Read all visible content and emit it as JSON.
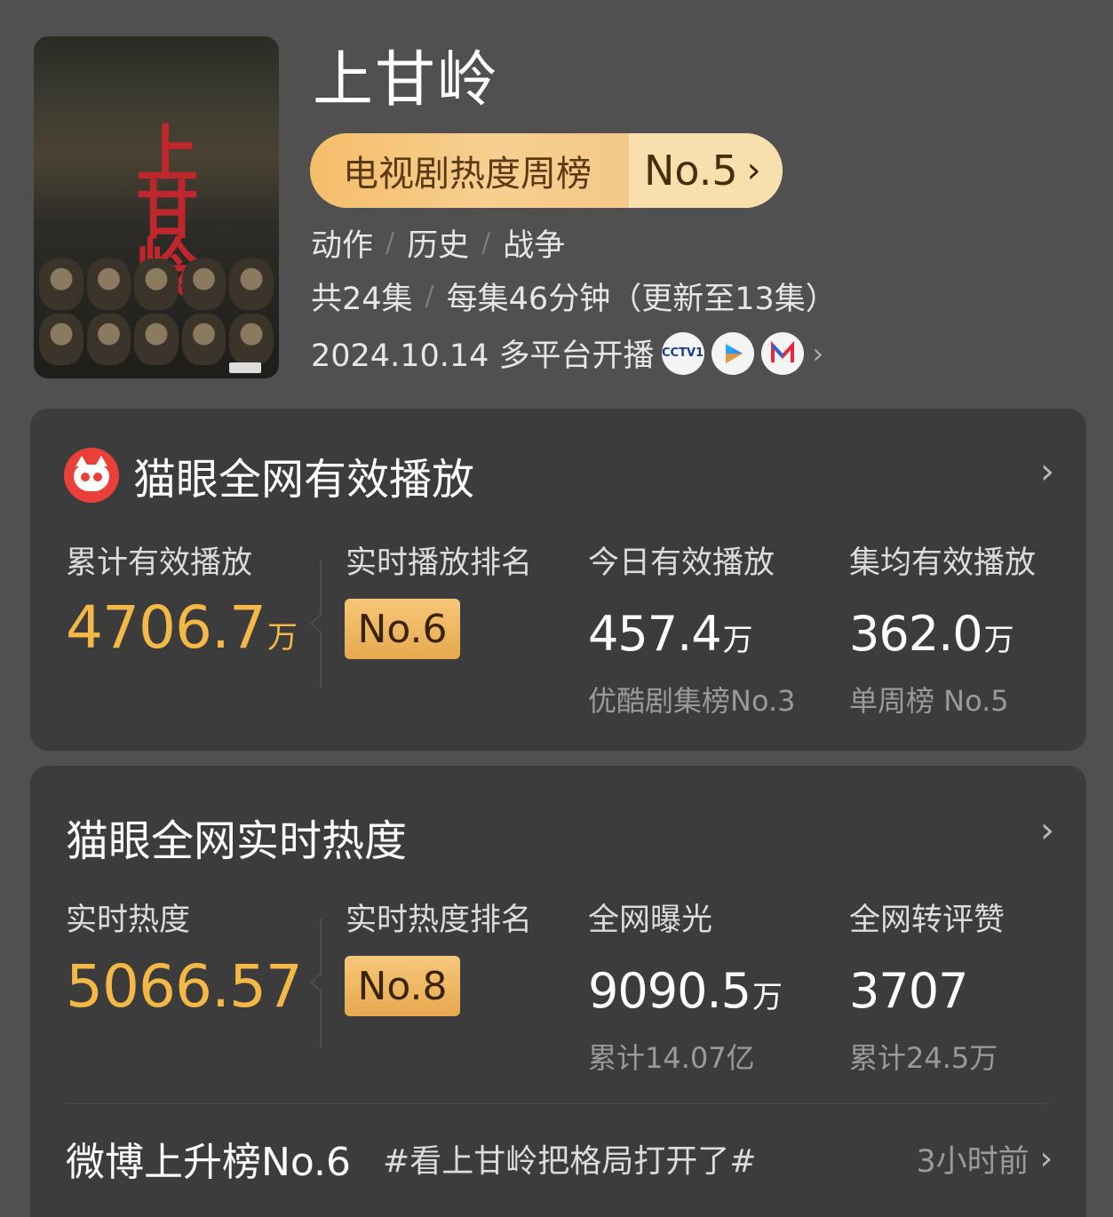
{
  "header": {
    "title": "上甘岭",
    "poster_text": "上甘岭",
    "rank_pill": {
      "label": "电视剧热度周榜",
      "rank": "No.5",
      "chevron": "›"
    },
    "genres": [
      "动作",
      "历史",
      "战争"
    ],
    "separator": "/",
    "episodes": {
      "count": "共24集",
      "duration": "每集46分钟（更新至13集）"
    },
    "release": {
      "text": "2024.10.14 多平台开播",
      "chevron": "›"
    },
    "platforms": [
      {
        "icon": "cctv1-icon",
        "label": "CCTV1"
      },
      {
        "icon": "youku-icon",
        "label": ""
      },
      {
        "icon": "mgtv-icon",
        "label": ""
      }
    ]
  },
  "playback_card": {
    "title": "猫眼全网有效播放",
    "chevron": "›",
    "cumulative": {
      "label": "累计有效播放",
      "value": "4706.7",
      "unit": "万"
    },
    "realtime_rank": {
      "label": "实时播放排名",
      "value": "No.6"
    },
    "today": {
      "label": "今日有效播放",
      "value": "457.4",
      "unit": "万",
      "sub": "优酷剧集榜No.3"
    },
    "per_episode": {
      "label": "集均有效播放",
      "value": "362.0",
      "unit": "万",
      "sub": "单周榜 No.5"
    }
  },
  "heat_card": {
    "title": "猫眼全网实时热度",
    "chevron": "›",
    "realtime_heat": {
      "label": "实时热度",
      "value": "5066.57"
    },
    "heat_rank": {
      "label": "实时热度排名",
      "value": "No.8"
    },
    "exposure": {
      "label": "全网曝光",
      "value": "9090.5",
      "unit": "万",
      "sub": "累计14.07亿"
    },
    "engagement": {
      "label": "全网转评赞",
      "value": "3707",
      "sub": "累计24.5万"
    },
    "weibo": {
      "rank": "微博上升榜No.6",
      "tag": "#看上甘岭把格局打开了#",
      "time": "3小时前",
      "chevron": "›"
    }
  },
  "colors": {
    "background": "#505050",
    "card": "#3c3c3c",
    "gold": "#f3b846",
    "badge": "#eab256"
  }
}
